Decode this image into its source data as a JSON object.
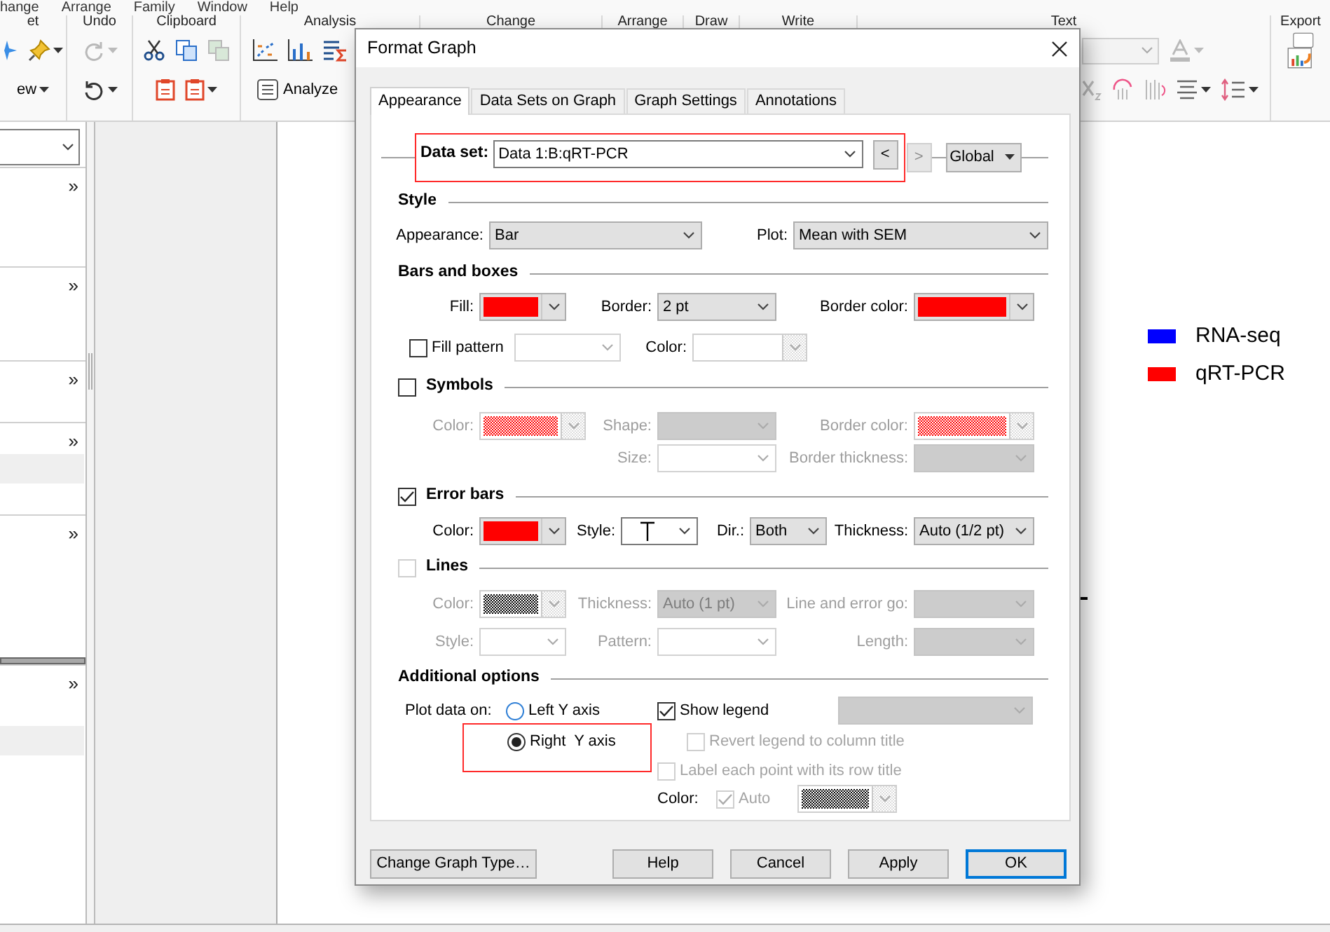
{
  "menu": [
    {
      "label": "hange"
    },
    {
      "label": "Arrange"
    },
    {
      "label": "Family"
    },
    {
      "label": "Window"
    },
    {
      "label": "Help"
    }
  ],
  "ribbon": [
    {
      "label": "et",
      "rows": [
        [
          {
            "kind": "sparkle",
            "disabled": false,
            "menu": false
          },
          {
            "kind": "pin",
            "disabled": false,
            "menu": true
          }
        ],
        [
          {
            "kind": "text",
            "label": "ew",
            "disabled": false,
            "menu": true
          }
        ]
      ]
    },
    {
      "label": "Undo",
      "rows": [
        [
          {
            "kind": "redo",
            "disabled": true,
            "menu": true
          }
        ],
        [
          {
            "kind": "undo",
            "disabled": false,
            "menu": true
          }
        ]
      ]
    },
    {
      "label": "Clipboard",
      "rows": [
        [
          {
            "kind": "cut",
            "disabled": false,
            "menu": false
          },
          {
            "kind": "copy",
            "disabled": false,
            "menu": false
          },
          {
            "kind": "pages",
            "disabled": true,
            "menu": false
          }
        ],
        [
          {
            "kind": "paste",
            "disabled": false,
            "menu": false
          },
          {
            "kind": "paste",
            "disabled": false,
            "menu": true
          }
        ]
      ]
    },
    {
      "label": "Analysis",
      "rows": [
        [
          {
            "kind": "xy",
            "disabled": false,
            "menu": false
          },
          {
            "kind": "bars",
            "disabled": false,
            "menu": false
          },
          {
            "kind": "sigma",
            "disabled": false,
            "menu": false
          }
        ],
        [
          {
            "kind": "button",
            "label": "Analyze",
            "disabled": false,
            "menu": false
          }
        ]
      ]
    },
    {
      "label": "Change"
    },
    {
      "label": "Arrange"
    },
    {
      "label": "Draw"
    },
    {
      "label": "Write"
    },
    {
      "label": "Text",
      "rows": [
        [
          {
            "kind": "font-field",
            "disabled": true,
            "menu": false
          },
          {
            "kind": "font-color",
            "disabled": true,
            "menu": true
          }
        ],
        [
          {
            "kind": "subscript",
            "disabled": true,
            "menu": false
          },
          {
            "kind": "rotate",
            "disabled": true,
            "menu": false
          },
          {
            "kind": "vertical",
            "disabled": true,
            "menu": false
          },
          {
            "kind": "align",
            "disabled": false,
            "menu": true
          },
          {
            "kind": "spacing",
            "disabled": false,
            "menu": true
          }
        ]
      ]
    },
    {
      "label": "Export",
      "rows": [
        [
          {
            "kind": "export",
            "disabled": false,
            "menu": false
          }
        ]
      ]
    }
  ],
  "navigator": {
    "sections": [
      {
        "expander": "»",
        "highlight": false
      },
      {
        "expander": "»",
        "highlight": false
      },
      {
        "expander": "»",
        "highlight": false
      },
      {
        "expander": "»",
        "highlight": true
      },
      {
        "expander": "»",
        "highlight": false
      },
      {
        "expander": "»",
        "highlight": true
      }
    ]
  },
  "legend": [
    {
      "label": "RNA-seq",
      "color": "#0000ff"
    },
    {
      "label": "qRT-PCR",
      "color": "#ff0000"
    }
  ],
  "dialog": {
    "title": "Format Graph",
    "tabs": [
      {
        "label": "Appearance",
        "selected": true
      },
      {
        "label": "Data Sets on Graph",
        "selected": false
      },
      {
        "label": "Graph Settings",
        "selected": false
      },
      {
        "label": "Annotations",
        "selected": false
      }
    ],
    "data_set": {
      "label": "Data set:",
      "value": "Data 1:B:qRT-PCR",
      "highlighted": true,
      "prev": {
        "label": "<",
        "disabled": false
      },
      "next": {
        "label": ">",
        "disabled": true
      },
      "scope": "Global"
    },
    "sections": [
      {
        "title": "Style",
        "kind": "plain",
        "rows": [
          {
            "fields": [
              {
                "kind": "label",
                "text": "Appearance:",
                "disabled": false
              },
              {
                "kind": "combo",
                "value": "Bar",
                "disabled": false,
                "editable": false,
                "shaded": false
              },
              {
                "kind": "label",
                "text": "Plot:",
                "disabled": false
              },
              {
                "kind": "combo",
                "value": "Mean with SEM",
                "disabled": false,
                "editable": false,
                "shaded": false
              }
            ]
          }
        ]
      },
      {
        "title": "Bars and boxes",
        "kind": "plain",
        "rows": [
          {
            "fields": [
              {
                "kind": "label",
                "text": "Fill:",
                "disabled": false
              },
              {
                "kind": "color",
                "color": "#ff0000",
                "pattern": false,
                "disabled": false
              },
              {
                "kind": "label",
                "text": "Border:",
                "disabled": false
              },
              {
                "kind": "combo",
                "value": "2 pt",
                "disabled": false,
                "editable": false,
                "shaded": false
              },
              {
                "kind": "label",
                "text": "Border color:",
                "disabled": false
              },
              {
                "kind": "color",
                "color": "#ff0000",
                "pattern": false,
                "disabled": false
              }
            ]
          },
          {
            "fields": [
              {
                "kind": "checkbox",
                "label": "Fill pattern",
                "checked": false,
                "disabled": false
              },
              {
                "kind": "combo",
                "disabled": true,
                "editable": true,
                "shaded": false
              },
              {
                "kind": "label",
                "text": "Color:",
                "disabled": false
              },
              {
                "kind": "color",
                "disabled": true
              }
            ]
          }
        ]
      },
      {
        "title": "Symbols",
        "kind": "checkbox",
        "checked": false,
        "disabled": false,
        "rows": [
          {
            "fields": [
              {
                "kind": "label",
                "text": "Color:",
                "disabled": true
              },
              {
                "kind": "color",
                "color": "#ff0000",
                "pattern": true,
                "disabled": true
              },
              {
                "kind": "label",
                "text": "Shape:",
                "disabled": true
              },
              {
                "kind": "combo",
                "disabled": true,
                "editable": false,
                "shaded": true
              },
              {
                "kind": "label",
                "text": "Border color:",
                "disabled": true
              },
              {
                "kind": "color",
                "color": "#ff0000",
                "pattern": true,
                "disabled": true
              }
            ]
          },
          {
            "fields": [
              {
                "kind": "label",
                "text": "Size:",
                "disabled": true
              },
              {
                "kind": "combo",
                "disabled": true,
                "editable": true,
                "shaded": false
              },
              {
                "kind": "label",
                "text": "Border thickness:",
                "disabled": true
              },
              {
                "kind": "combo",
                "disabled": true,
                "editable": false,
                "shaded": true
              }
            ]
          }
        ]
      },
      {
        "title": "Error bars",
        "kind": "checkbox",
        "checked": true,
        "disabled": false,
        "rows": [
          {
            "fields": [
              {
                "kind": "label",
                "text": "Color:",
                "disabled": false
              },
              {
                "kind": "color",
                "color": "#ff0000",
                "pattern": false,
                "disabled": false
              },
              {
                "kind": "label",
                "text": "Style:",
                "disabled": false
              },
              {
                "kind": "cap-combo",
                "disabled": false,
                "editable": true,
                "shaded": false
              },
              {
                "kind": "label",
                "text": "Dir.:",
                "disabled": false
              },
              {
                "kind": "combo",
                "value": "Both",
                "disabled": false,
                "editable": false,
                "shaded": false
              },
              {
                "kind": "label",
                "text": "Thickness:",
                "disabled": false
              },
              {
                "kind": "combo",
                "value": "Auto (1/2 pt)",
                "disabled": false,
                "editable": false,
                "shaded": false
              }
            ]
          }
        ]
      },
      {
        "title": "Lines",
        "kind": "checkbox",
        "checked": false,
        "disabled": true,
        "rows": [
          {
            "fields": [
              {
                "kind": "label",
                "text": "Color:",
                "disabled": true
              },
              {
                "kind": "color",
                "color": "#000000",
                "pattern": true,
                "disabled": true
              },
              {
                "kind": "label",
                "text": "Thickness:",
                "disabled": true
              },
              {
                "kind": "combo",
                "value": "Auto (1 pt)",
                "disabled": true,
                "editable": false,
                "shaded": true
              },
              {
                "kind": "label",
                "text": "Line and error go:",
                "disabled": true
              },
              {
                "kind": "combo",
                "disabled": true,
                "editable": false,
                "shaded": true
              }
            ]
          },
          {
            "fields": [
              {
                "kind": "label",
                "text": "Style:",
                "disabled": true
              },
              {
                "kind": "combo",
                "disabled": true,
                "editable": true,
                "shaded": false
              },
              {
                "kind": "label",
                "text": "Pattern:",
                "disabled": true
              },
              {
                "kind": "combo",
                "disabled": true,
                "editable": true,
                "shaded": false
              },
              {
                "kind": "label",
                "text": "Length:",
                "disabled": true
              },
              {
                "kind": "combo",
                "disabled": true,
                "editable": false,
                "shaded": true
              }
            ]
          }
        ]
      },
      {
        "title": "Additional options",
        "kind": "plain",
        "rows": [
          {
            "fields": [
              {
                "kind": "label",
                "text": "Plot data on:",
                "disabled": false
              },
              {
                "kind": "radio",
                "label": "Left Y axis",
                "selected": false,
                "highlighted": false
              },
              {
                "kind": "checkbox",
                "label": "Show legend",
                "checked": true,
                "disabled": false
              },
              {
                "kind": "combo",
                "disabled": true,
                "editable": false,
                "shaded": true
              },
              {
                "kind": "radio",
                "label": "Right  Y axis",
                "selected": true,
                "highlighted": true
              },
              {
                "kind": "checkbox",
                "label": "Revert legend to column title",
                "checked": false,
                "disabled": true
              },
              {
                "kind": "checkbox",
                "label": "Label each point with its row title",
                "checked": false,
                "disabled": true
              },
              {
                "kind": "label",
                "text": "Color:",
                "disabled": false
              },
              {
                "kind": "checkbox",
                "label": "Auto",
                "checked": true,
                "disabled": true
              },
              {
                "kind": "color",
                "color": "#000000",
                "pattern": true,
                "disabled": true
              }
            ]
          }
        ]
      }
    ],
    "buttons": [
      {
        "label": "Change Graph Type…",
        "default": false
      },
      {
        "label": "Help",
        "default": false
      },
      {
        "label": "Cancel",
        "default": false
      },
      {
        "label": "Apply",
        "default": false
      },
      {
        "label": "OK",
        "default": true
      }
    ]
  }
}
